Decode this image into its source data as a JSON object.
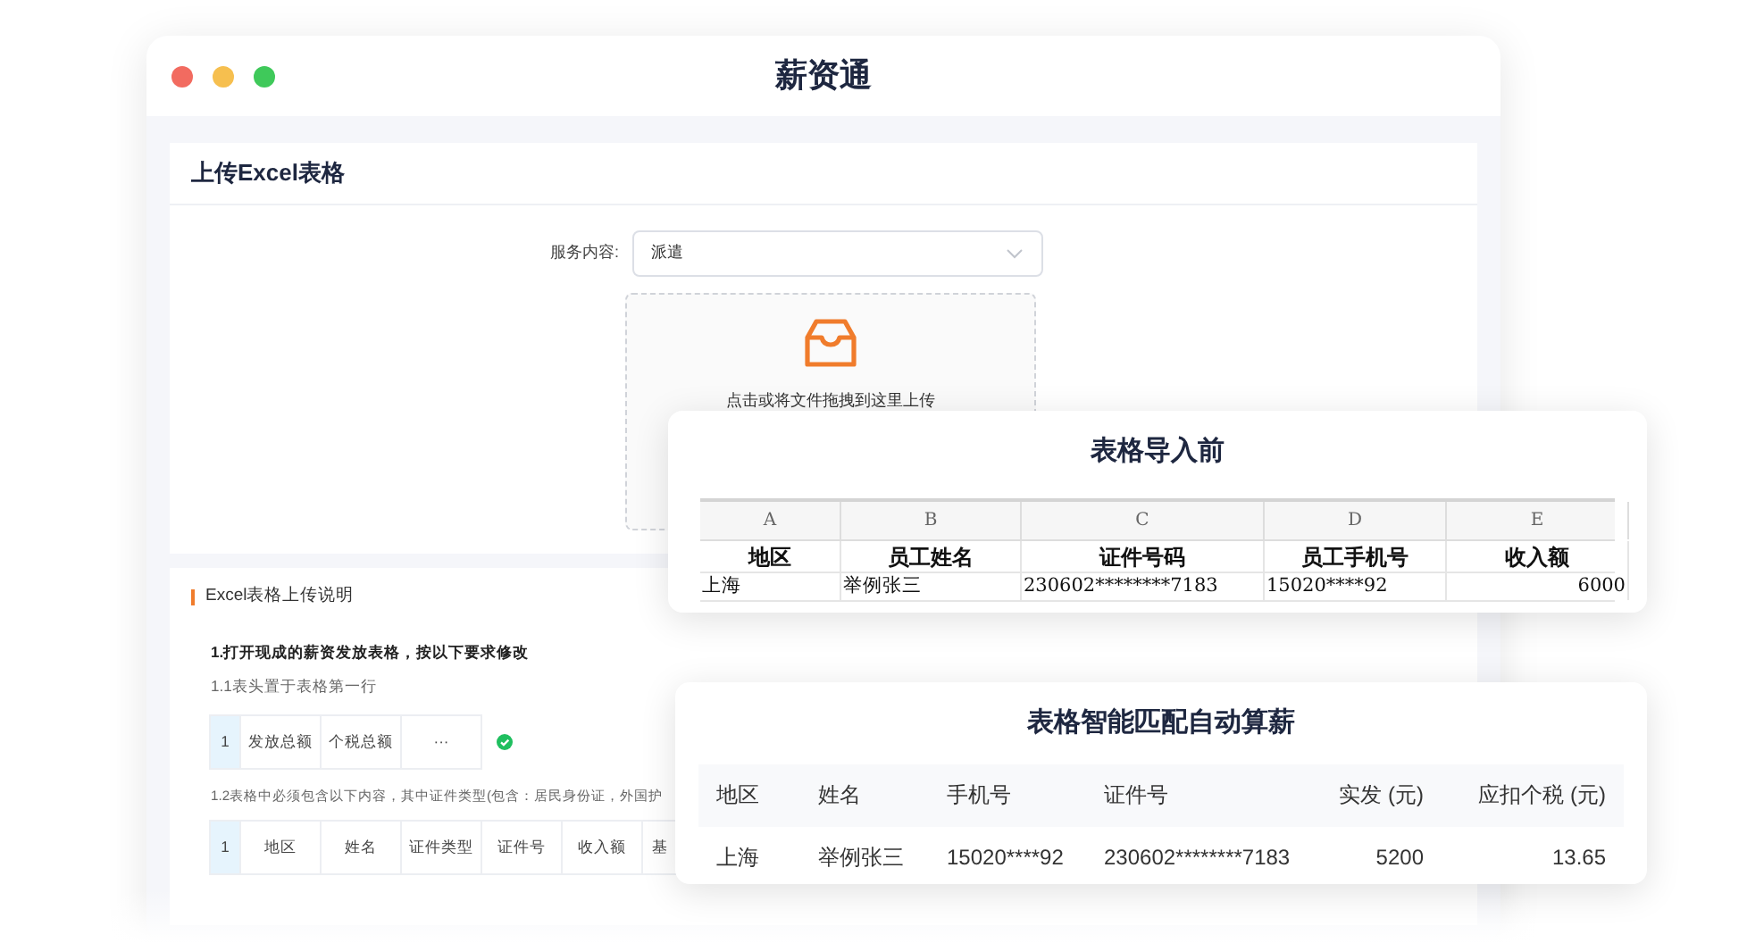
{
  "window": {
    "title": "薪资通"
  },
  "upload_panel": {
    "title": "上传Excel表格",
    "service_field": {
      "label": "服务内容:",
      "value": "派遣"
    },
    "dropzone": {
      "text": "点击或将文件拖拽到这里上传"
    }
  },
  "instructions": {
    "title": "Excel表格上传说明",
    "heading": "1.打开现成的薪资发放表格，按以下要求修改",
    "sub_1": {
      "text": "1.1表头置于表格第一行",
      "cells": [
        "1",
        "发放总额",
        "个税总额",
        "···"
      ]
    },
    "sub_2": {
      "text": "1.2表格中必须包含以下内容，其中证件类型(包含：居民身份证，外国护",
      "cells": [
        "1",
        "地区",
        "姓名",
        "证件类型",
        "证件号",
        "收入额",
        "基"
      ]
    }
  },
  "before_card": {
    "title": "表格导入前",
    "column_letters": [
      "A",
      "B",
      "C",
      "D",
      "E"
    ],
    "header": [
      "地区",
      "员工姓名",
      "证件号码",
      "员工手机号",
      "收入额"
    ],
    "row": [
      "上海",
      "举例张三",
      "230602********7183",
      "15020****92",
      "6000"
    ]
  },
  "after_card": {
    "title": "表格智能匹配自动算薪",
    "columns": [
      "地区",
      "姓名",
      "手机号",
      "证件号",
      "实发 (元)",
      "应扣个税 (元)"
    ],
    "row": [
      "上海",
      "举例张三",
      "15020****92",
      "230602********7183",
      "5200",
      "13.65"
    ]
  }
}
